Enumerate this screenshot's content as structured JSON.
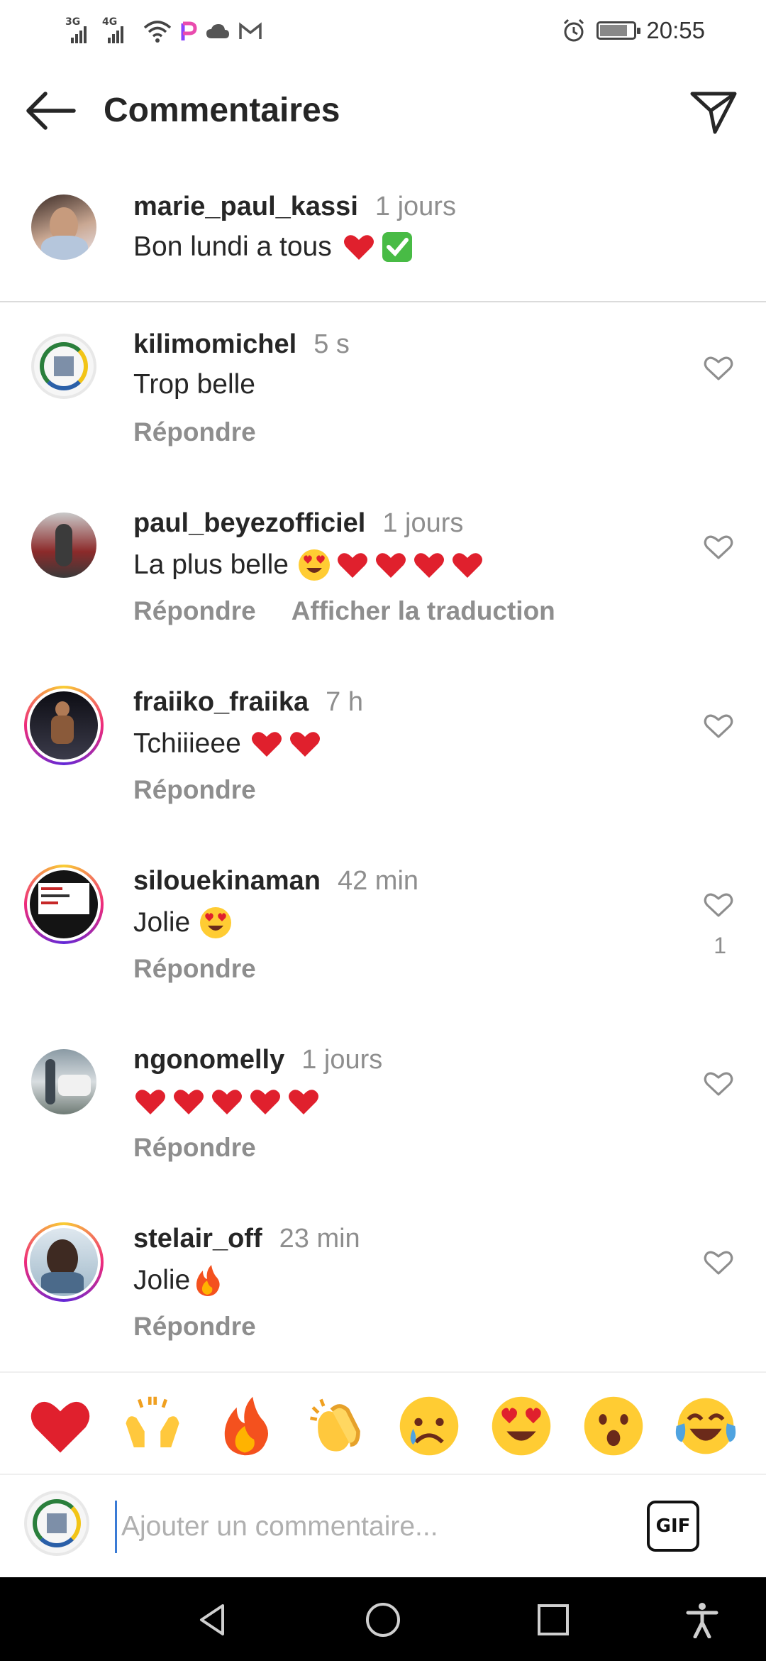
{
  "status": {
    "net1": "3G",
    "net2": "4G",
    "time": "20:55",
    "battery_level": 0.75
  },
  "header": {
    "title": "Commentaires",
    "back_icon": "arrow-left-icon",
    "share_icon": "paper-plane-icon"
  },
  "caption": {
    "username": "marie_paul_kassi",
    "ago": "1 jours",
    "text": "Bon lundi a tous"
  },
  "comments": [
    {
      "username": "kilimomichel",
      "ago": "5 s",
      "text": "Trop belle",
      "reply": "Répondre",
      "translate": "",
      "likes": ""
    },
    {
      "username": "paul_beyezofficiel",
      "ago": "1 jours",
      "text": "La plus belle",
      "reply": "Répondre",
      "translate": "Afficher la traduction",
      "likes": ""
    },
    {
      "username": "fraiiko_fraiika",
      "ago": "7 h",
      "text": "Tchiiieee",
      "reply": "Répondre",
      "translate": "",
      "likes": ""
    },
    {
      "username": "silouekinaman",
      "ago": "42 min",
      "text": "Jolie",
      "reply": "Répondre",
      "translate": "",
      "likes": "1"
    },
    {
      "username": "ngonomelly",
      "ago": "1 jours",
      "text": "",
      "reply": "Répondre",
      "translate": "",
      "likes": ""
    },
    {
      "username": "stelair_off",
      "ago": "23 min",
      "text": "Jolie",
      "reply": "Répondre",
      "translate": "",
      "likes": ""
    }
  ],
  "reactions": [
    "red-heart",
    "raising-hands",
    "fire",
    "clapping-hands",
    "crying-face",
    "heart-eyes",
    "surprised-face",
    "tears-of-joy"
  ],
  "composer": {
    "placeholder": "Ajouter un commentaire...",
    "gif_label": "GIF"
  },
  "colors": {
    "heart": "#e0202d",
    "muted": "#8e8e8e",
    "text": "#262626"
  }
}
